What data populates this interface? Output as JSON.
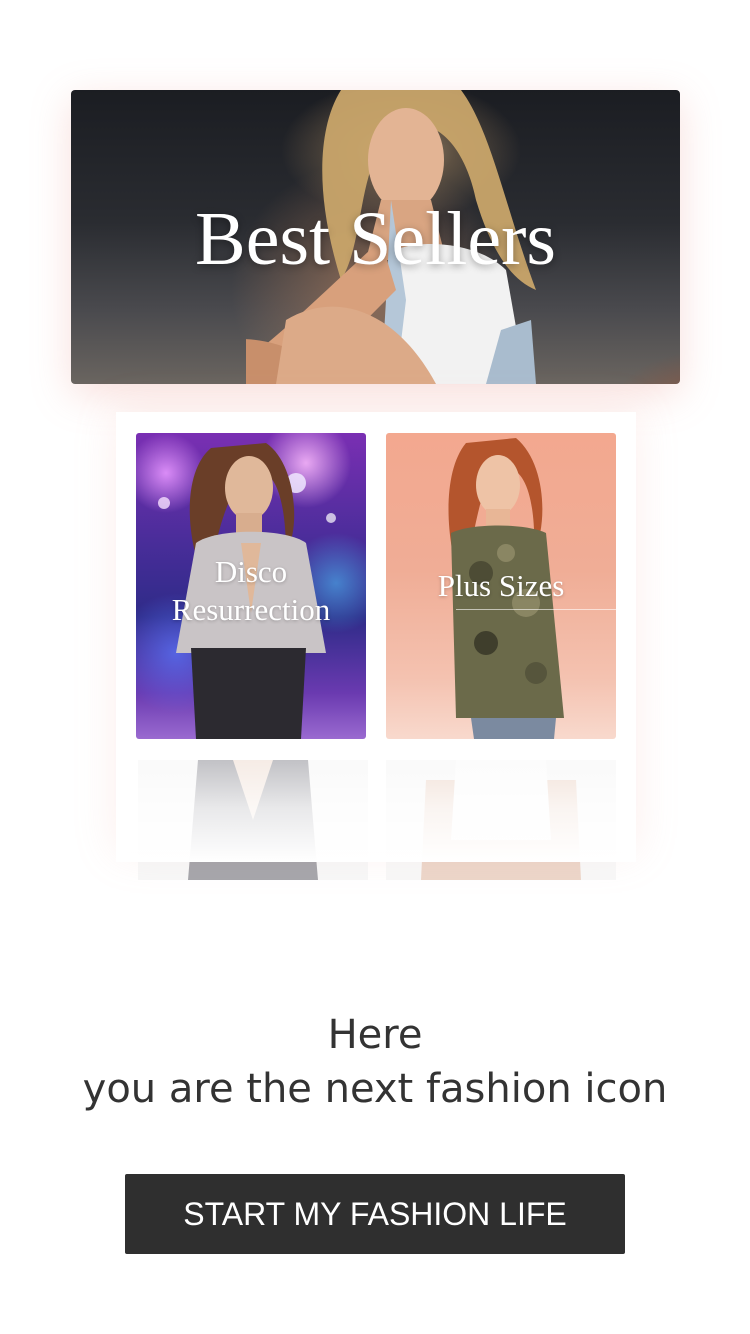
{
  "hero": {
    "title": "Best Sellers"
  },
  "categories": [
    {
      "label": "Disco\nResurrection"
    },
    {
      "label": "Plus Sizes"
    }
  ],
  "tagline": {
    "line1": "Here",
    "line2": "you are the next fashion icon"
  },
  "cta": {
    "label": "START MY FASHION LIFE"
  },
  "colors": {
    "button_bg": "#2f2f2f",
    "text_dark": "#333333",
    "shadow_tint": "#f0a090"
  },
  "icons": {
    "hero_image": "woman-sitting-on-rocks-photo",
    "disco_image": "woman-in-metallic-jacket-photo",
    "plus_image": "woman-in-camo-jacket-photo"
  }
}
